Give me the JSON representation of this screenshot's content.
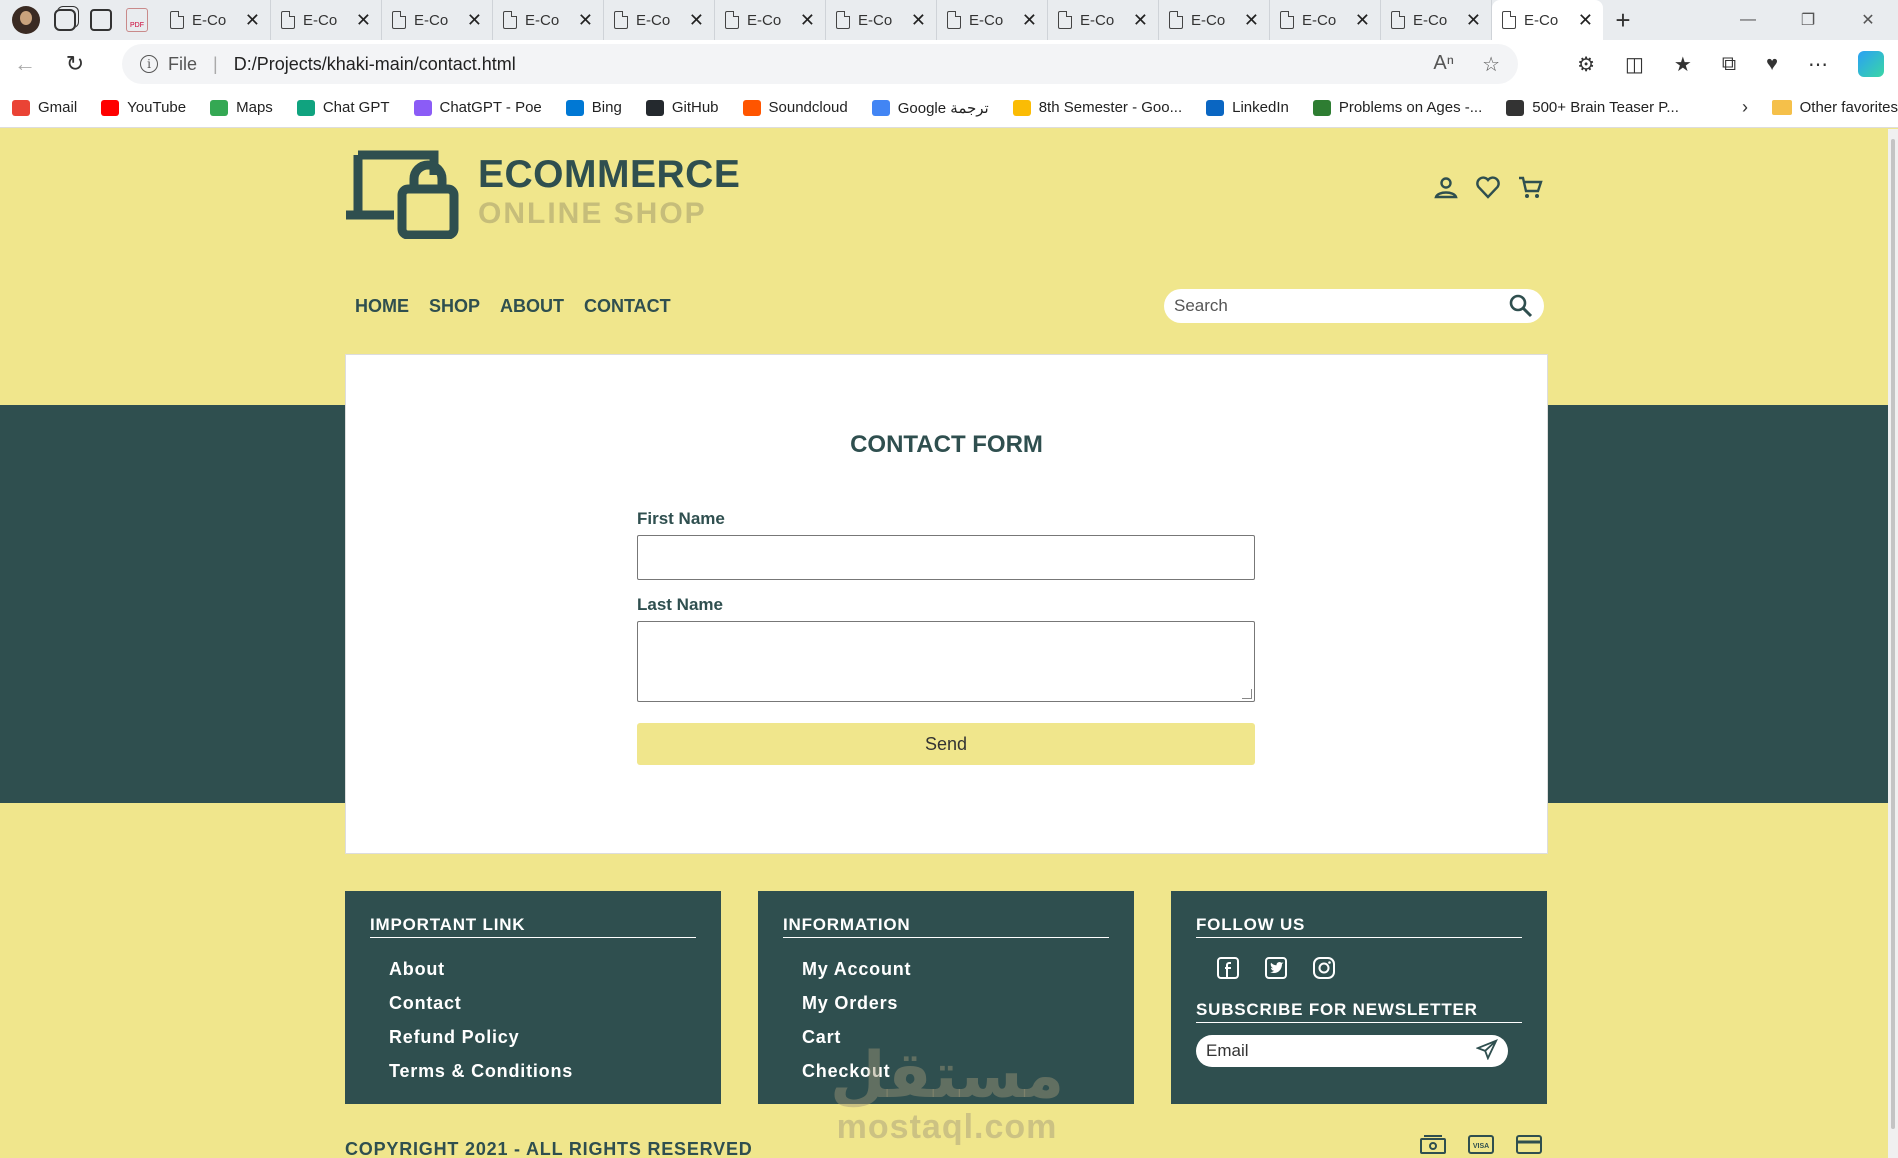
{
  "browser": {
    "tabs": [
      {
        "title": "E-Co"
      },
      {
        "title": "E-Co"
      },
      {
        "title": "E-Co"
      },
      {
        "title": "E-Co"
      },
      {
        "title": "E-Co"
      },
      {
        "title": "E-Co"
      },
      {
        "title": "E-Co"
      },
      {
        "title": "E-Co"
      },
      {
        "title": "E-Co"
      },
      {
        "title": "E-Co"
      },
      {
        "title": "E-Co"
      },
      {
        "title": "E-Co"
      },
      {
        "title": "E-Co"
      }
    ],
    "active_tab_index": 12,
    "url_scheme": "File",
    "url": "D:/Projects/khaki-main/contact.html",
    "bookmarks": [
      {
        "label": "Gmail",
        "color": "#ea4335"
      },
      {
        "label": "YouTube",
        "color": "#ff0000"
      },
      {
        "label": "Maps",
        "color": "#34a853"
      },
      {
        "label": "Chat GPT",
        "color": "#10a37f"
      },
      {
        "label": "ChatGPT - Poe",
        "color": "#8b5cf6"
      },
      {
        "label": "Bing",
        "color": "#0078d4"
      },
      {
        "label": "GitHub",
        "color": "#24292e"
      },
      {
        "label": "Soundcloud",
        "color": "#ff5500"
      },
      {
        "label": "Google ترجمة",
        "color": "#4285f4"
      },
      {
        "label": "8th Semester - Goo...",
        "color": "#fbbc04"
      },
      {
        "label": "LinkedIn",
        "color": "#0a66c2"
      },
      {
        "label": "Problems on Ages -...",
        "color": "#2e7d32"
      },
      {
        "label": "500+ Brain Teaser P...",
        "color": "#333333"
      }
    ],
    "other_favorites": "Other favorites"
  },
  "site": {
    "brand_primary": "#2f4f4f",
    "brand_accent": "#f0e68c",
    "logo_line1": "ECOMMERCE",
    "logo_line2": "ONLINE SHOP",
    "header_icons": [
      "user-icon",
      "heart-icon",
      "cart-icon"
    ],
    "nav": [
      "HOME",
      "SHOP",
      "ABOUT",
      "CONTACT"
    ],
    "search_placeholder": "Search"
  },
  "contact_form": {
    "title": "CONTACT FORM",
    "first_name_label": "First Name",
    "first_name_value": "",
    "last_name_label": "Last Name",
    "last_name_value": "",
    "send_label": "Send"
  },
  "footer": {
    "important_links": {
      "title": "IMPORTANT LINK",
      "items": [
        "About",
        "Contact",
        "Refund Policy",
        "Terms & Conditions"
      ]
    },
    "information": {
      "title": "INFORMATION",
      "items": [
        "My Account",
        "My Orders",
        "Cart",
        "Checkout"
      ]
    },
    "follow": {
      "title": "FOLLOW US",
      "icons": [
        "facebook-icon",
        "twitter-icon",
        "instagram-icon"
      ],
      "newsletter_title": "SUBSCRIBE FOR NEWSLETTER",
      "email_placeholder": "Email"
    },
    "copyright": "COPYRIGHT 2021 - ALL RIGHTS RESERVED",
    "payment_icons": [
      "cash-icon",
      "visa-icon",
      "card-icon"
    ]
  },
  "watermark": {
    "arabic": "مستقل",
    "latin": "mostaql.com"
  }
}
